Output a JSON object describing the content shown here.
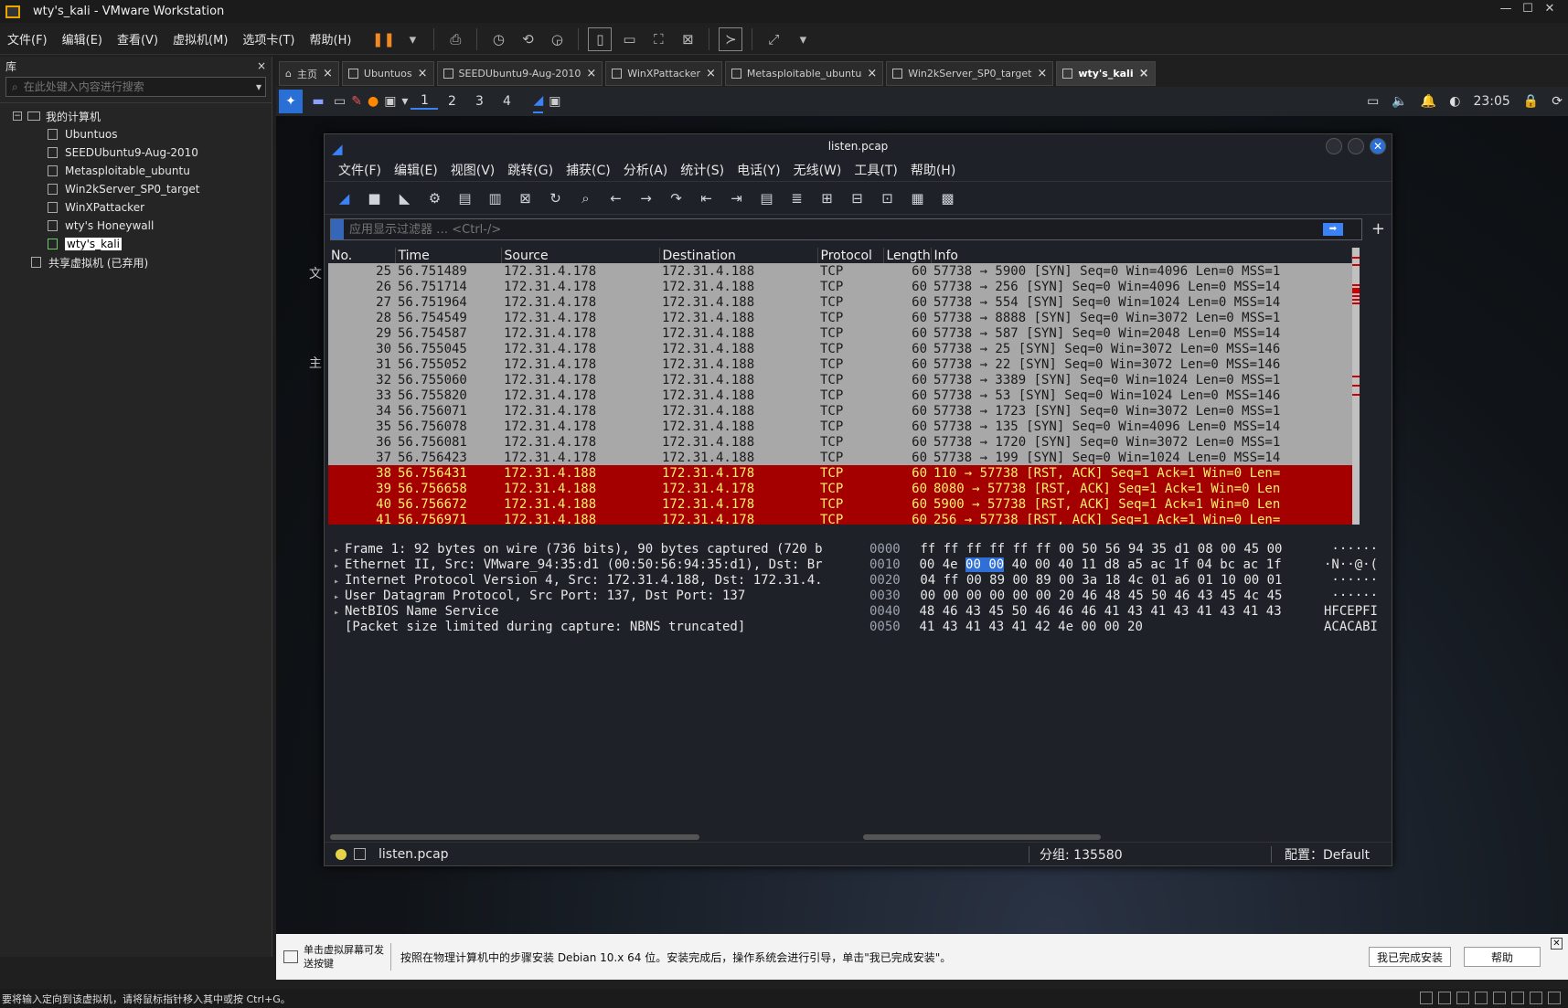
{
  "window": {
    "title": "wty's_kali - VMware Workstation",
    "min": "—",
    "max": "☐",
    "close": "✕"
  },
  "menu": [
    "文件(F)",
    "编辑(E)",
    "查看(V)",
    "虚拟机(M)",
    "选项卡(T)",
    "帮助(H)"
  ],
  "library": {
    "title": "库",
    "close": "×",
    "search_placeholder": "在此处键入内容进行搜索",
    "root": "我的计算机",
    "vms": [
      "Ubuntuos",
      "SEEDUbuntu9-Aug-2010",
      "Metasploitable_ubuntu",
      "Win2kServer_SP0_target",
      "WinXPattacker",
      "wty's Honeywall",
      "wty's_kali"
    ],
    "selected": "wty's_kali",
    "shared": "共享虚拟机 (已弃用)"
  },
  "tabs": [
    "主页",
    "Ubuntuos",
    "SEEDUbuntu9-Aug-2010",
    "WinXPattacker",
    "Metasploitable_ubuntu",
    "Win2kServer_SP0_target",
    "wty's_kali"
  ],
  "active_tab": "wty's_kali",
  "guest_panel": {
    "workspaces": [
      "1",
      "2",
      "3",
      "4"
    ],
    "time": "23:05"
  },
  "desktop_frags": {
    "a": "文",
    "b": "主"
  },
  "wireshark": {
    "title": "listen.pcap",
    "menu": [
      "文件(F)",
      "编辑(E)",
      "视图(V)",
      "跳转(G)",
      "捕获(C)",
      "分析(A)",
      "统计(S)",
      "电话(Y)",
      "无线(W)",
      "工具(T)",
      "帮助(H)"
    ],
    "filter_placeholder": "应用显示过滤器 … <Ctrl-/>",
    "columns": [
      "No.",
      "Time",
      "Source",
      "Destination",
      "Protocol",
      "Length",
      "Info"
    ],
    "packets": [
      {
        "no": "25",
        "time": "56.751489",
        "src": "172.31.4.178",
        "dst": "172.31.4.188",
        "proto": "TCP",
        "len": "60",
        "info": "57738 → 5900 [SYN] Seq=0 Win=4096 Len=0 MSS=1",
        "type": "syn"
      },
      {
        "no": "26",
        "time": "56.751714",
        "src": "172.31.4.178",
        "dst": "172.31.4.188",
        "proto": "TCP",
        "len": "60",
        "info": "57738 → 256 [SYN] Seq=0 Win=4096 Len=0 MSS=14",
        "type": "syn"
      },
      {
        "no": "27",
        "time": "56.751964",
        "src": "172.31.4.178",
        "dst": "172.31.4.188",
        "proto": "TCP",
        "len": "60",
        "info": "57738 → 554 [SYN] Seq=0 Win=1024 Len=0 MSS=14",
        "type": "syn"
      },
      {
        "no": "28",
        "time": "56.754549",
        "src": "172.31.4.178",
        "dst": "172.31.4.188",
        "proto": "TCP",
        "len": "60",
        "info": "57738 → 8888 [SYN] Seq=0 Win=3072 Len=0 MSS=1",
        "type": "syn"
      },
      {
        "no": "29",
        "time": "56.754587",
        "src": "172.31.4.178",
        "dst": "172.31.4.188",
        "proto": "TCP",
        "len": "60",
        "info": "57738 → 587 [SYN] Seq=0 Win=2048 Len=0 MSS=14",
        "type": "syn"
      },
      {
        "no": "30",
        "time": "56.755045",
        "src": "172.31.4.178",
        "dst": "172.31.4.188",
        "proto": "TCP",
        "len": "60",
        "info": "57738 → 25 [SYN] Seq=0 Win=3072 Len=0 MSS=146",
        "type": "syn"
      },
      {
        "no": "31",
        "time": "56.755052",
        "src": "172.31.4.178",
        "dst": "172.31.4.188",
        "proto": "TCP",
        "len": "60",
        "info": "57738 → 22 [SYN] Seq=0 Win=3072 Len=0 MSS=146",
        "type": "syn"
      },
      {
        "no": "32",
        "time": "56.755060",
        "src": "172.31.4.178",
        "dst": "172.31.4.188",
        "proto": "TCP",
        "len": "60",
        "info": "57738 → 3389 [SYN] Seq=0 Win=1024 Len=0 MSS=1",
        "type": "syn"
      },
      {
        "no": "33",
        "time": "56.755820",
        "src": "172.31.4.178",
        "dst": "172.31.4.188",
        "proto": "TCP",
        "len": "60",
        "info": "57738 → 53 [SYN] Seq=0 Win=1024 Len=0 MSS=146",
        "type": "syn"
      },
      {
        "no": "34",
        "time": "56.756071",
        "src": "172.31.4.178",
        "dst": "172.31.4.188",
        "proto": "TCP",
        "len": "60",
        "info": "57738 → 1723 [SYN] Seq=0 Win=3072 Len=0 MSS=1",
        "type": "syn"
      },
      {
        "no": "35",
        "time": "56.756078",
        "src": "172.31.4.178",
        "dst": "172.31.4.188",
        "proto": "TCP",
        "len": "60",
        "info": "57738 → 135 [SYN] Seq=0 Win=4096 Len=0 MSS=14",
        "type": "syn"
      },
      {
        "no": "36",
        "time": "56.756081",
        "src": "172.31.4.178",
        "dst": "172.31.4.188",
        "proto": "TCP",
        "len": "60",
        "info": "57738 → 1720 [SYN] Seq=0 Win=3072 Len=0 MSS=1",
        "type": "syn"
      },
      {
        "no": "37",
        "time": "56.756423",
        "src": "172.31.4.178",
        "dst": "172.31.4.188",
        "proto": "TCP",
        "len": "60",
        "info": "57738 → 199 [SYN] Seq=0 Win=1024 Len=0 MSS=14",
        "type": "syn"
      },
      {
        "no": "38",
        "time": "56.756431",
        "src": "172.31.4.188",
        "dst": "172.31.4.178",
        "proto": "TCP",
        "len": "60",
        "info": "110 → 57738 [RST, ACK] Seq=1 Ack=1 Win=0 Len=",
        "type": "rst"
      },
      {
        "no": "39",
        "time": "56.756658",
        "src": "172.31.4.188",
        "dst": "172.31.4.178",
        "proto": "TCP",
        "len": "60",
        "info": "8080 → 57738 [RST, ACK] Seq=1 Ack=1 Win=0 Len",
        "type": "rst"
      },
      {
        "no": "40",
        "time": "56.756672",
        "src": "172.31.4.188",
        "dst": "172.31.4.178",
        "proto": "TCP",
        "len": "60",
        "info": "5900 → 57738 [RST, ACK] Seq=1 Ack=1 Win=0 Len",
        "type": "rst"
      },
      {
        "no": "41",
        "time": "56.756971",
        "src": "172.31.4.188",
        "dst": "172.31.4.178",
        "proto": "TCP",
        "len": "60",
        "info": "256 → 57738 [RST, ACK] Seq=1 Ack=1 Win=0 Len=",
        "type": "rst"
      }
    ],
    "details": [
      {
        "text": "Frame 1: 92 bytes on wire (736 bits), 90 bytes captured (720 b",
        "expand": true
      },
      {
        "text": "Ethernet II, Src: VMware_94:35:d1 (00:50:56:94:35:d1), Dst: Br",
        "expand": true
      },
      {
        "text": "Internet Protocol Version 4, Src: 172.31.4.188, Dst: 172.31.4.",
        "expand": true
      },
      {
        "text": "User Datagram Protocol, Src Port: 137, Dst Port: 137",
        "expand": true
      },
      {
        "text": "NetBIOS Name Service",
        "expand": true
      },
      {
        "text": "[Packet size limited during capture: NBNS truncated]",
        "expand": false
      }
    ],
    "hex": [
      {
        "off": "0000",
        "pre": "ff ff ff ff ff ff 00 50  56 94 35 d1 08 00 45 00",
        "hl": "",
        "post": "",
        "ascii": "······"
      },
      {
        "off": "0010",
        "pre": "00 4e ",
        "hl": "00 00",
        "post": " 40 00 40 11  d8 a5 ac 1f 04 bc ac 1f",
        "ascii": "·N··@·("
      },
      {
        "off": "0020",
        "pre": "04 ff 00 89 00 89 00 3a  18 4c 01 a6 01 10 00 01",
        "hl": "",
        "post": "",
        "ascii": "······"
      },
      {
        "off": "0030",
        "pre": "00 00 00 00 00 00 20 46  48 45 50 46 43 45 4c 45",
        "hl": "",
        "post": "",
        "ascii": "······"
      },
      {
        "off": "0040",
        "pre": "48 46 43 45 50 46 46 46  41 43 41 43 41 43 41 43",
        "hl": "",
        "post": "",
        "ascii": "HFCEPFI"
      },
      {
        "off": "0050",
        "pre": "41 43 41 43 41 42 4e 00  00 20",
        "hl": "",
        "post": "",
        "ascii": "ACACABI"
      }
    ],
    "status": {
      "file": "listen.pcap",
      "packets": "分组: 135580",
      "profile": "配置：Default"
    }
  },
  "notify": {
    "hint": "单击虚拟屏幕可发送按键",
    "message": "按照在物理计算机中的步骤安装 Debian 10.x 64 位。安装完成后，操作系统会进行引导，单击\"我已完成安装\"。",
    "done_button": "我已完成安装",
    "help_button": "帮助"
  },
  "statusbar": "要将输入定向到该虚拟机，请将鼠标指针移入其中或按 Ctrl+G。"
}
